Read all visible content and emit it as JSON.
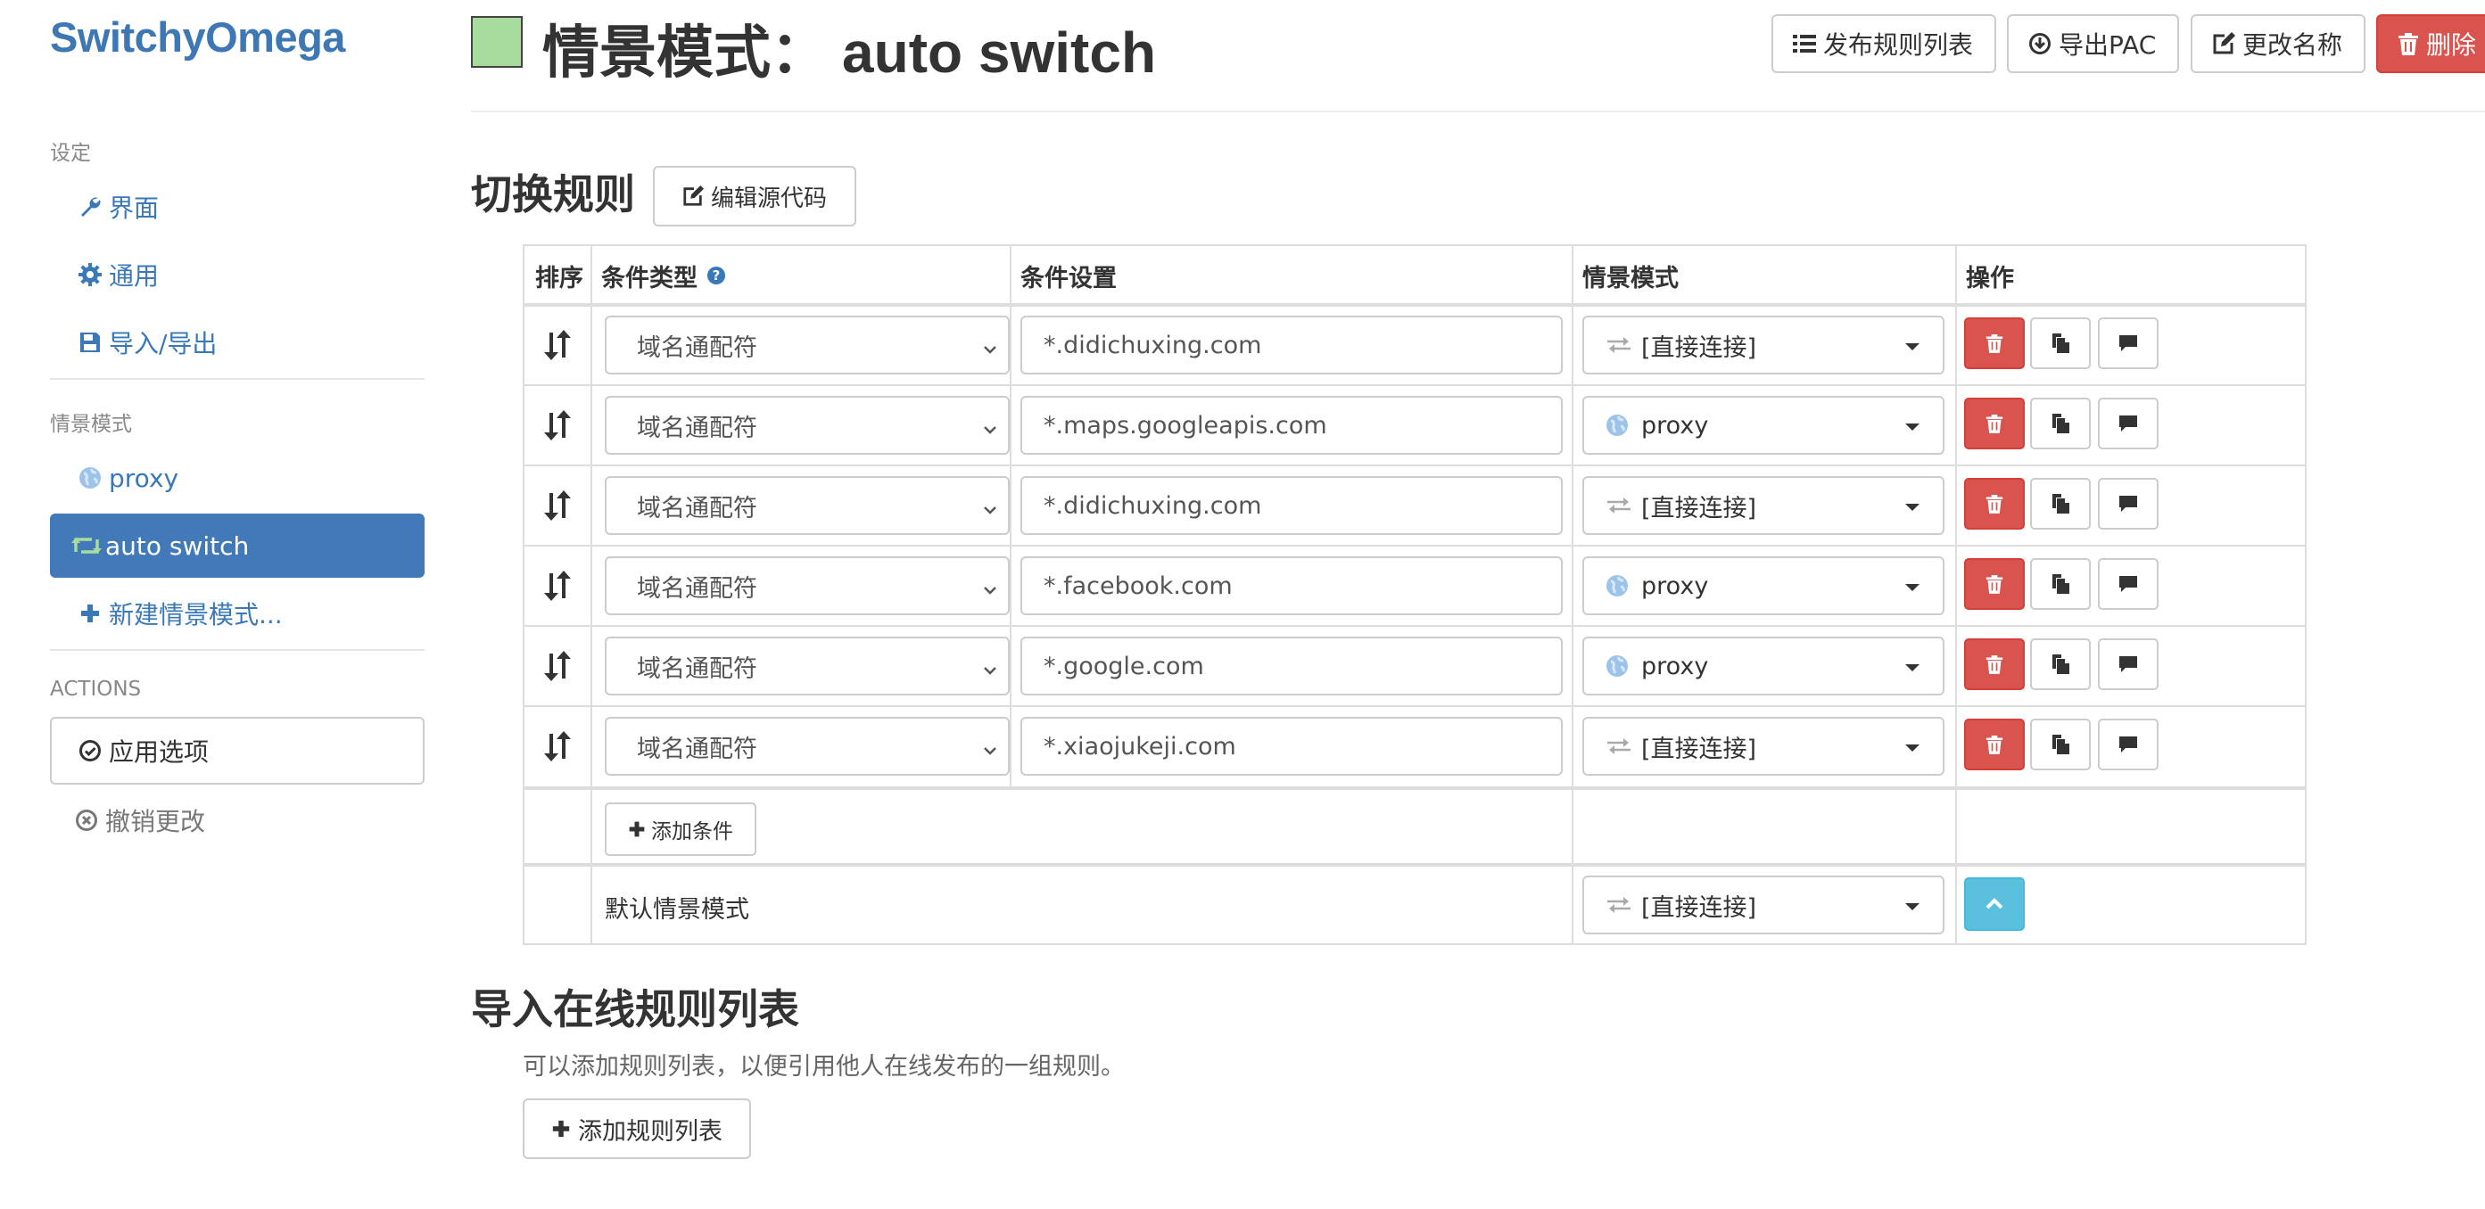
{
  "sidebar": {
    "brand": "SwitchyOmega",
    "settings_header": "设定",
    "settings_items": [
      {
        "label": "界面",
        "icon": "wrench-icon"
      },
      {
        "label": "通用",
        "icon": "gear-icon"
      },
      {
        "label": "导入/导出",
        "icon": "floppy-icon"
      }
    ],
    "profiles_header": "情景模式",
    "profiles": [
      {
        "label": "proxy",
        "icon": "globe-icon",
        "active": false
      },
      {
        "label": "auto switch",
        "icon": "retweet-icon",
        "active": true
      }
    ],
    "new_profile_label": "新建情景模式...",
    "actions_header": "ACTIONS",
    "apply_label": "应用选项",
    "discard_label": "撤销更改"
  },
  "header": {
    "title_prefix": "情景模式：",
    "profile_name": "auto switch",
    "profile_color": "#a8dc9e",
    "buttons": {
      "publish": "发布规则列表",
      "export_pac": "导出PAC",
      "rename": "更改名称",
      "delete": "删除"
    }
  },
  "switch_rules": {
    "title": "切换规则",
    "edit_source_label": "编辑源代码",
    "columns": {
      "sort": "排序",
      "condition_type": "条件类型",
      "condition": "条件设置",
      "profile": "情景模式",
      "actions": "操作"
    },
    "rules": [
      {
        "condition_type": "域名通配符",
        "condition": "*.didichuxing.com",
        "profile": "[直接连接]",
        "profile_icon": "direct-icon"
      },
      {
        "condition_type": "域名通配符",
        "condition": "*.maps.googleapis.com",
        "profile": "proxy",
        "profile_icon": "globe-icon"
      },
      {
        "condition_type": "域名通配符",
        "condition": "*.didichuxing.com",
        "profile": "[直接连接]",
        "profile_icon": "direct-icon"
      },
      {
        "condition_type": "域名通配符",
        "condition": "*.facebook.com",
        "profile": "proxy",
        "profile_icon": "globe-icon"
      },
      {
        "condition_type": "域名通配符",
        "condition": "*.google.com",
        "profile": "proxy",
        "profile_icon": "globe-icon"
      },
      {
        "condition_type": "域名通配符",
        "condition": "*.xiaojukeji.com",
        "profile": "[直接连接]",
        "profile_icon": "direct-icon"
      }
    ],
    "add_condition_label": "添加条件",
    "default_label": "默认情景模式",
    "default_profile": "[直接连接]"
  },
  "online_rules": {
    "title": "导入在线规则列表",
    "description": "可以添加规则列表，以便引用他人在线发布的一组规则。",
    "add_label": "添加规则列表"
  },
  "colors": {
    "brand": "#3d78b5",
    "active_item": "#4279b9",
    "danger": "#d9534f",
    "info": "#5bc0de"
  }
}
